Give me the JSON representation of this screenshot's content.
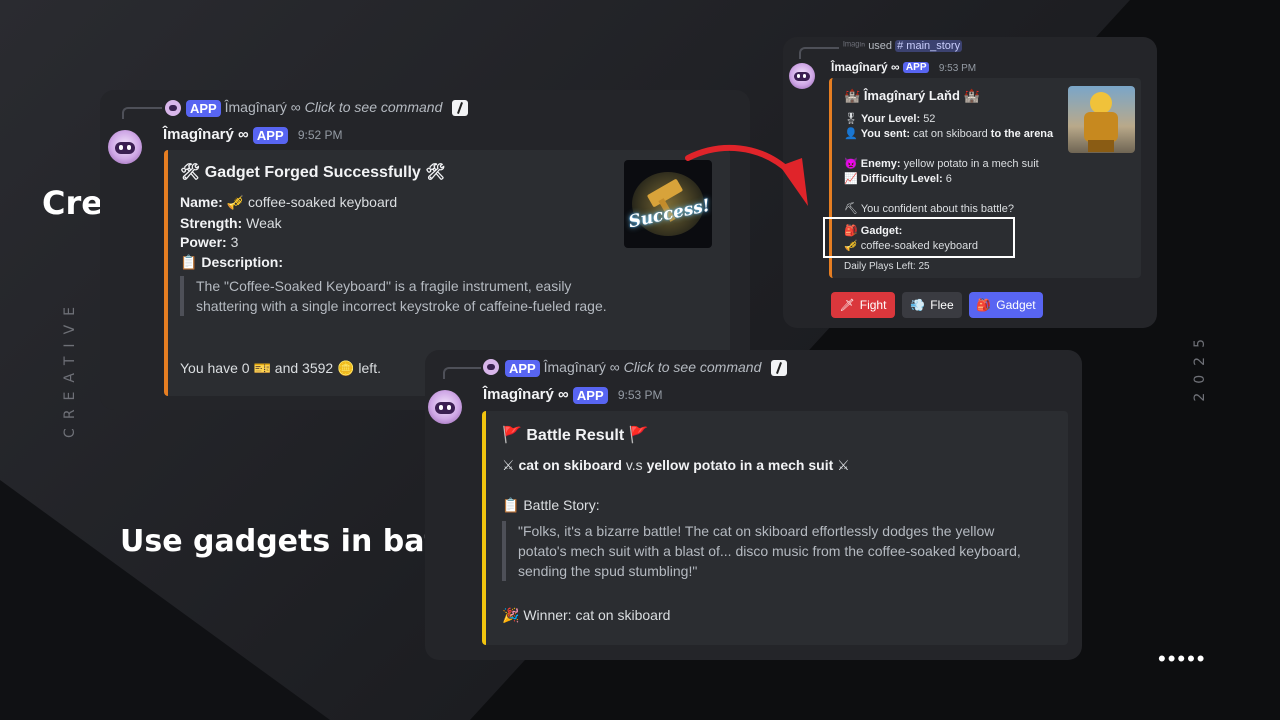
{
  "side": {
    "left": "CREATIVE",
    "right": "2025",
    "dots": "•••••"
  },
  "captions": {
    "create": "Create!",
    "battle": "Use gadgets in battle!"
  },
  "card1": {
    "reply_app": "APP",
    "reply_user": "Îmagînarý ∞",
    "reply_text": "Click to see command",
    "username": "Îmagînarý ∞",
    "app": "APP",
    "time": "9:52 PM",
    "title": "Gadget Forged Successfully",
    "name_label": "Name:",
    "name_value": "coffee-soaked keyboard",
    "strength_label": "Strength:",
    "strength_value": "Weak",
    "power_label": "Power:",
    "power_value": "3",
    "desc_label": "Description:",
    "desc_text": "The \"Coffee-Soaked Keyboard\" is a fragile instrument, easily shattering with a single incorrect keystroke of caffeine-fueled rage.",
    "footer_pre": "You have 0",
    "footer_mid": "and 3592",
    "footer_post": "left.",
    "thumb_text": "Success!"
  },
  "card2": {
    "reply_user": "ᴵᵐᵃᵍᶦⁿ",
    "reply_used": "used",
    "reply_cmd": "# main_story",
    "username": "Îmagînarý ∞",
    "app": "APP",
    "time": "9:53 PM",
    "title": "Îmagînarý Laňd",
    "level_label": "Your Level:",
    "level_value": "52",
    "sent_label": "You sent:",
    "sent_value": "cat on skiboard",
    "sent_post": "to the arena",
    "enemy_label": "Enemy:",
    "enemy_value": "yellow potato in a mech suit",
    "diff_label": "Difficulty Level:",
    "diff_value": "6",
    "confident": "You confident about this battle?",
    "gadget_label": "Gadget:",
    "gadget_value": "coffee-soaked keyboard",
    "plays": "Daily Plays Left: 25",
    "buttons": {
      "fight": "Fight",
      "flee": "Flee",
      "gadget": "Gadget"
    }
  },
  "card3": {
    "reply_app": "APP",
    "reply_user": "Îmagînarý ∞",
    "reply_text": "Click to see command",
    "username": "Îmagînarý ∞",
    "app": "APP",
    "time": "9:53 PM",
    "title": "Battle Result",
    "fighter1": "cat on skiboard",
    "vs": "v.s",
    "fighter2": "yellow potato in a mech suit",
    "story_label": "Battle Story:",
    "story_text": "\"Folks, it's a bizarre battle! The cat on skiboard effortlessly dodges the yellow potato's mech suit with a blast of... disco music from the coffee-soaked keyboard, sending the spud stumbling!\"",
    "winner": "Winner: cat on skiboard"
  },
  "colors": {
    "accent": "#5865f2",
    "orange": "#e67e22",
    "yellow": "#f1c40f",
    "red": "#da373c"
  }
}
